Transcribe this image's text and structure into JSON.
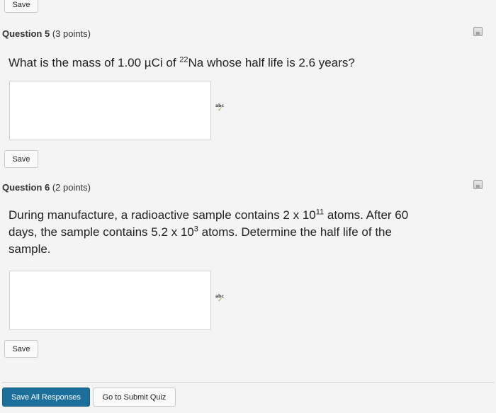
{
  "top_save": "Save",
  "q5": {
    "label": "Question 5",
    "points": "(3 points)",
    "text_pre": "What is the mass of 1.00 µCi of ",
    "sup": "22",
    "text_post": "Na whose half life is 2.6 years?",
    "save": "Save"
  },
  "q6": {
    "label": "Question 6",
    "points": "(2 points)",
    "line1_pre": "During manufacture, a radioactive sample contains 2 x 10",
    "line1_sup": "11",
    "line1_post": " atoms. After 60",
    "line2_pre": "days, the sample contains 5.2 x 10",
    "line2_sup": "3",
    "line2_post": " atoms. Determine the half life of the",
    "line3": "sample.",
    "save": "Save"
  },
  "footer": {
    "save_all": "Save All Responses",
    "submit": "Go to Submit Quiz"
  },
  "icons": {
    "spellcheck": "spellcheck-icon",
    "save": "save-status-icon"
  },
  "colors": {
    "primary": "#1c6f9a",
    "background": "#f4f4f4"
  }
}
